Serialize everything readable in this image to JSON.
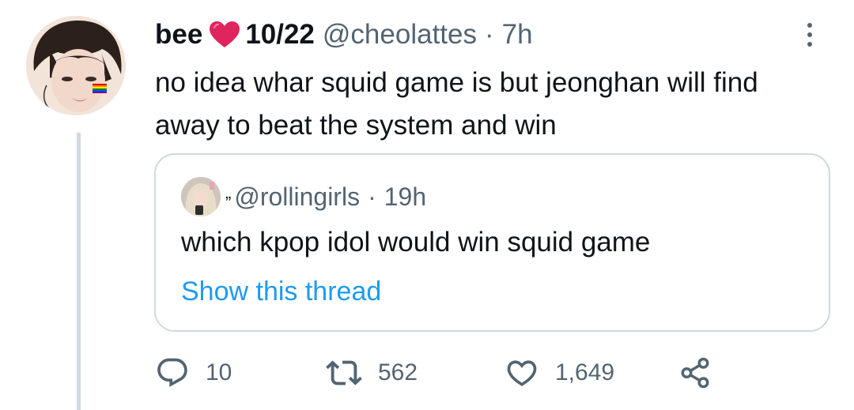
{
  "tweet": {
    "display_name": "bee",
    "display_name_suffix": "10/22",
    "handle": "@cheolattes",
    "separator": "·",
    "time": "7h",
    "text": "no idea whar squid game is but jeonghan will find away to beat the system and win",
    "avatar_icon": "profile-photo",
    "heart_color": "#e0245e"
  },
  "quote": {
    "name_mark": "„",
    "handle": "@rollingirls",
    "separator": "·",
    "time": "19h",
    "text": "which kpop idol would win squid game",
    "show_thread": "Show this thread"
  },
  "actions": {
    "reply_count": "10",
    "retweet_count": "562",
    "like_count": "1,649"
  },
  "colors": {
    "accent": "#1d9bf0",
    "secondary_text": "#536471",
    "border": "#cfd9de"
  }
}
